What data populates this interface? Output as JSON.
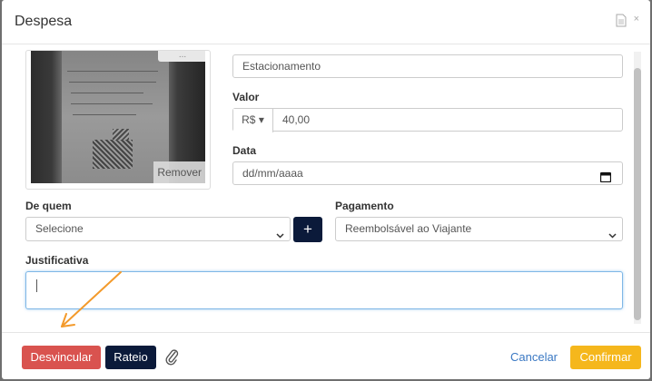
{
  "modal": {
    "title": "Despesa",
    "close_glyph": "×",
    "header_icon": "document-icon"
  },
  "receipt": {
    "remove_label": "Remover",
    "chip_text": "..."
  },
  "form": {
    "description_value": "Estacionamento",
    "valor_label": "Valor",
    "currency": "R$ ▾",
    "valor_value": "40,00",
    "data_label": "Data",
    "data_placeholder": "dd/mm/aaaa",
    "de_quem_label": "De quem",
    "de_quem_value": "Selecione",
    "add_glyph": "+",
    "pagamento_label": "Pagamento",
    "pagamento_value": "Reembolsável ao Viajante",
    "justificativa_label": "Justificativa"
  },
  "footer": {
    "desvincular_label": "Desvincular",
    "rateio_label": "Rateio",
    "cancel_label": "Cancelar",
    "confirm_label": "Confirmar"
  },
  "colors": {
    "danger": "#d9534f",
    "navy": "#0b1a3a",
    "confirm": "#f5b71c",
    "link": "#3a78c3",
    "annotation_arrow": "#f39a2b"
  }
}
